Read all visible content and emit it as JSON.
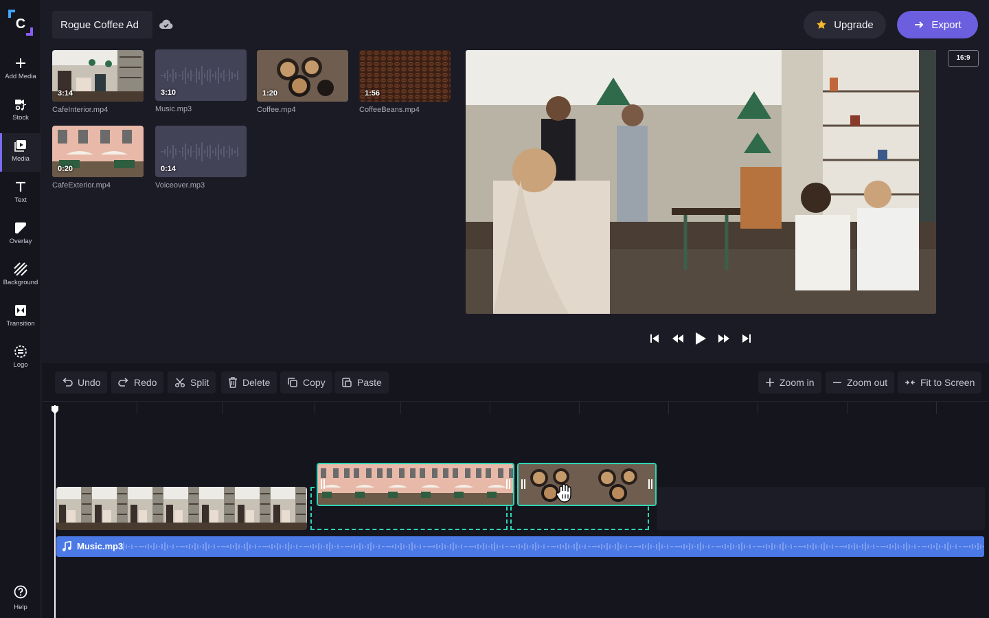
{
  "project": {
    "title": "Rogue Coffee Ad"
  },
  "header": {
    "upgrade_label": "Upgrade",
    "export_label": "Export",
    "aspect_ratio": "16:9"
  },
  "sidebar": {
    "items": [
      {
        "label": "Add Media",
        "icon": "plus-icon"
      },
      {
        "label": "Stock",
        "icon": "stock-icon"
      },
      {
        "label": "Media",
        "icon": "media-icon"
      },
      {
        "label": "Text",
        "icon": "text-icon"
      },
      {
        "label": "Overlay",
        "icon": "overlay-icon"
      },
      {
        "label": "Background",
        "icon": "background-icon"
      },
      {
        "label": "Transition",
        "icon": "transition-icon"
      },
      {
        "label": "Logo",
        "icon": "logo-icon"
      }
    ],
    "help_label": "Help"
  },
  "media": [
    {
      "name": "CafeInterior.mp4",
      "duration": "3:14",
      "kind": "video"
    },
    {
      "name": "Music.mp3",
      "duration": "3:10",
      "kind": "audio"
    },
    {
      "name": "Coffee.mp4",
      "duration": "1:20",
      "kind": "video"
    },
    {
      "name": "CoffeeBeans.mp4",
      "duration": "1:56",
      "kind": "video"
    },
    {
      "name": "CafeExterior.mp4",
      "duration": "0:20",
      "kind": "video"
    },
    {
      "name": "Voiceover.mp3",
      "duration": "0:14",
      "kind": "audio"
    }
  ],
  "toolbar": {
    "undo": "Undo",
    "redo": "Redo",
    "split": "Split",
    "delete": "Delete",
    "copy": "Copy",
    "paste": "Paste",
    "zoom_in": "Zoom in",
    "zoom_out": "Zoom out",
    "fit": "Fit to Screen"
  },
  "timeline": {
    "audio_clip_label": "Music.mp3"
  },
  "colors": {
    "accent": "#6b5fe0",
    "selection": "#2fd5b5",
    "audio": "#4b79e6",
    "upgrade_star": "#f5b82e"
  }
}
